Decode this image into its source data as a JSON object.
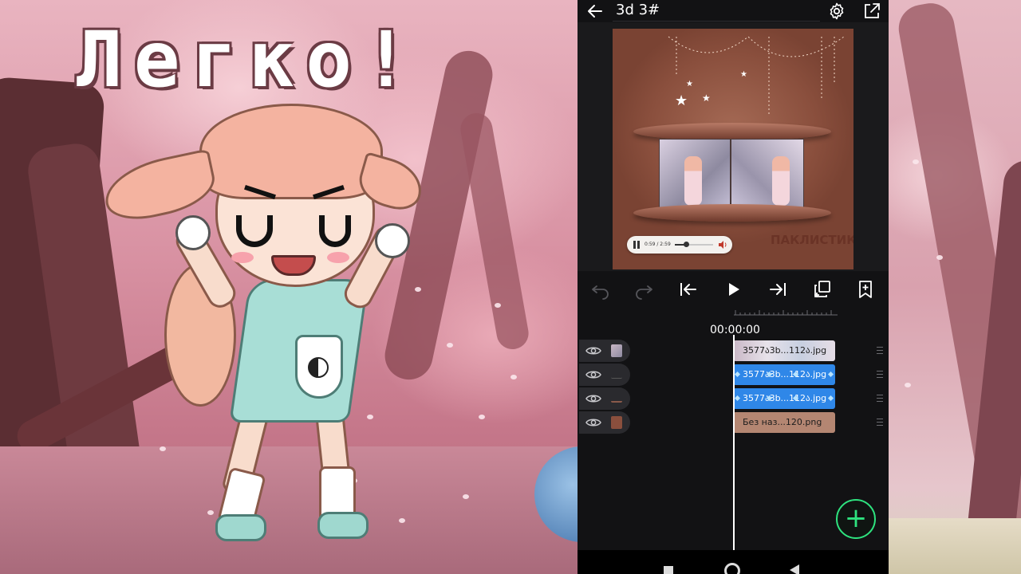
{
  "overlay": {
    "title": "Легко!"
  },
  "editor": {
    "project_title": "3d 3#",
    "back_icon": "arrow-left-icon",
    "settings_icon": "gear-icon",
    "export_icon": "export-icon",
    "preview": {
      "player_time": "0:59 / 2:59",
      "player_progress_fraction": 0.3,
      "watermark": "ПАКЛИСТИКА"
    },
    "toolbar": {
      "undo_icon": "undo-icon",
      "redo_icon": "redo-icon",
      "jump_start_icon": "skip-start-icon",
      "play_icon": "play-icon",
      "jump_end_icon": "skip-end-icon",
      "duplicate_icon": "duplicate-icon",
      "bookmark_icon": "bookmark-add-icon"
    },
    "timeline": {
      "timecode": "00:00:00",
      "tracks": [
        {
          "clip_label": "3577ა3b...112ა.jpg",
          "style": "img"
        },
        {
          "clip_label": "3577ა3b...112ა.jpg",
          "style": "blue"
        },
        {
          "clip_label": "3577ა3b...112ა.jpg",
          "style": "blue"
        },
        {
          "clip_label": "Без наз...120.png",
          "style": "brown"
        }
      ]
    },
    "fab_label": "+"
  },
  "colors": {
    "accent_green": "#2ee37f",
    "clip_blue": "#2f87e8",
    "clip_brown": "#b48672",
    "panel_bg": "#121214"
  }
}
